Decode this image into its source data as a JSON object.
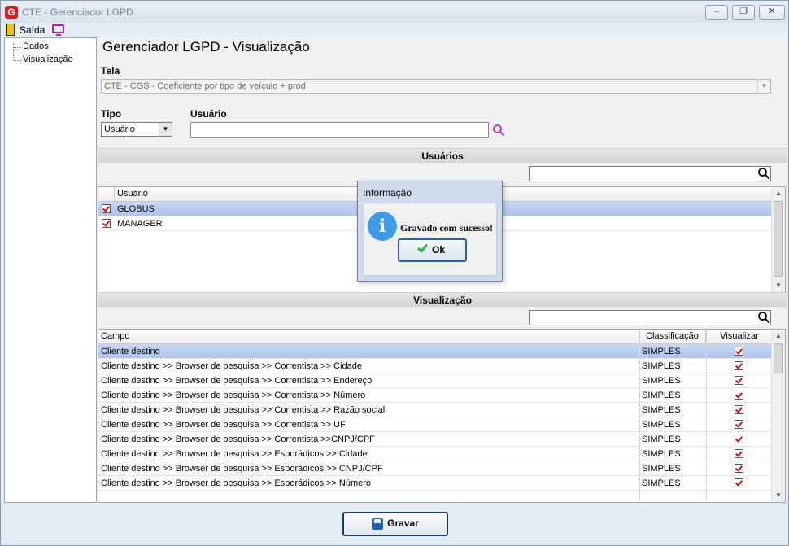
{
  "window": {
    "title": "CTE - Gerenciador LGPD",
    "min": "▭",
    "max": "◫",
    "close": "✕"
  },
  "toolbar": {
    "exit_label": "Saída"
  },
  "tree": {
    "items": [
      "Dados",
      "Visualização"
    ]
  },
  "main": {
    "title": "Gerenciador LGPD - Visualização",
    "tela_label": "Tela",
    "tela_value": "CTE - CGS - Coeficiente por tipo de veículo + prod",
    "tipo_label": "Tipo",
    "tipo_value": "Usuário",
    "usuario_label": "Usuário",
    "usuario_value": ""
  },
  "users_section": {
    "header": "Usuários",
    "column": "Usuário",
    "rows": [
      {
        "name": "GLOBUS",
        "checked": true
      },
      {
        "name": "MANAGER",
        "checked": true
      }
    ]
  },
  "view_section": {
    "header": "Visualização",
    "columns": [
      "Campo",
      "Classificação",
      "Visualizar"
    ],
    "rows": [
      [
        "Cliente destino",
        "SIMPLES"
      ],
      [
        "Cliente destino >> Browser de pesquisa >> Correntista >> Cidade",
        "SIMPLES"
      ],
      [
        "Cliente destino >> Browser de pesquisa >> Correntista >> Endereço",
        "SIMPLES"
      ],
      [
        "Cliente destino >> Browser de pesquisa >> Correntista >> Número",
        "SIMPLES"
      ],
      [
        "Cliente destino >> Browser de pesquisa >> Correntista >> Razão social",
        "SIMPLES"
      ],
      [
        "Cliente destino >> Browser de pesquisa >> Correntista >> UF",
        "SIMPLES"
      ],
      [
        "Cliente destino >> Browser de pesquisa >> Correntista >>CNPJ/CPF",
        "SIMPLES"
      ],
      [
        "Cliente destino >> Browser de pesquisa >> Esporádicos >> Cidade",
        "SIMPLES"
      ],
      [
        "Cliente destino >> Browser de pesquisa >> Esporádicos >> CNPJ/CPF",
        "SIMPLES"
      ],
      [
        "Cliente destino >> Browser de pesquisa >> Esporádicos >> Número",
        "SIMPLES"
      ]
    ]
  },
  "footer": {
    "save_label": "Gravar"
  },
  "dialog": {
    "title": "Informação",
    "message": "Gravado com sucesso!",
    "ok_label": "Ok"
  }
}
